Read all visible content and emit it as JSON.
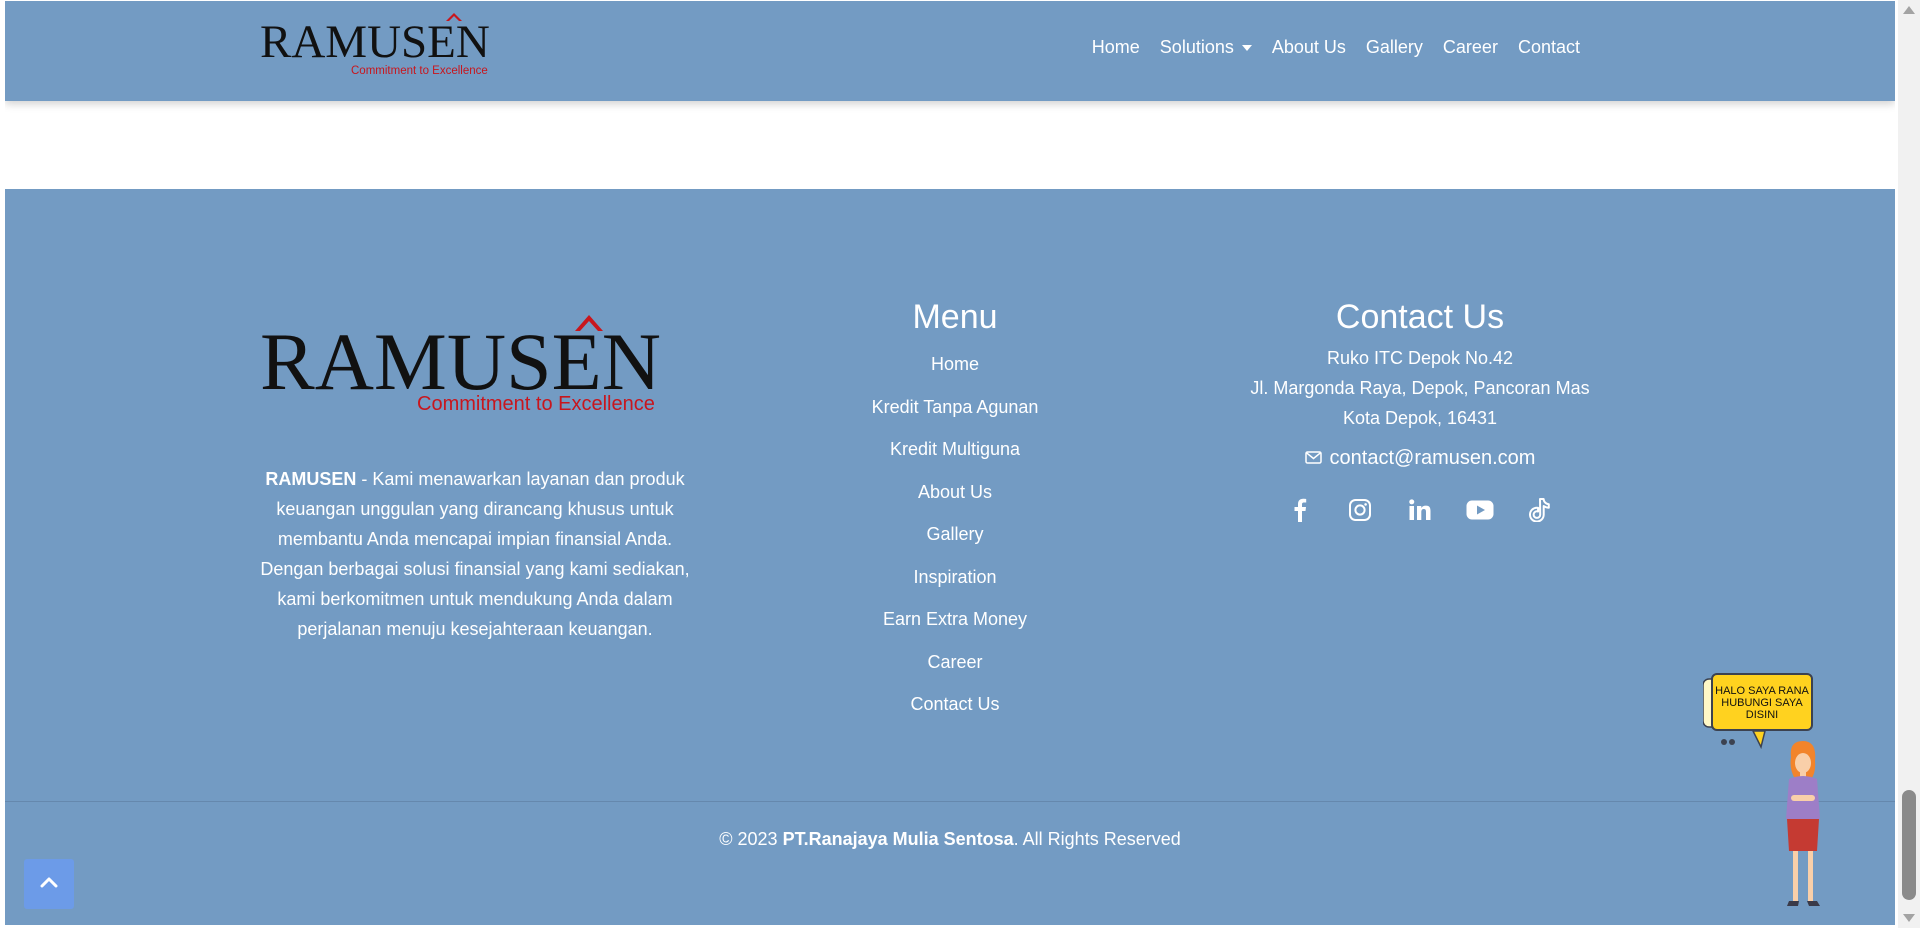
{
  "nav": {
    "logo_text": "RAMUSEN",
    "logo_tagline": "Commitment to Excellence",
    "items": [
      {
        "label": "Home"
      },
      {
        "label": "Solutions"
      },
      {
        "label": "About Us"
      },
      {
        "label": "Gallery"
      },
      {
        "label": "Career"
      },
      {
        "label": "Contact"
      }
    ]
  },
  "footer": {
    "logo_text": "RAMUSEN",
    "logo_tagline": "Commitment to Excellence",
    "about_brand": "RAMUSEN",
    "about_text": " - Kami menawarkan layanan dan produk keuangan unggulan yang dirancang khusus untuk membantu Anda mencapai impian finansial Anda. Dengan berbagai solusi finansial yang kami sediakan, kami berkomitmen untuk mendukung Anda dalam perjalanan menuju kesejahteraan keuangan.",
    "menu": {
      "heading": "Menu",
      "items": [
        {
          "label": "Home"
        },
        {
          "label": "Kredit Tanpa Agunan"
        },
        {
          "label": "Kredit Multiguna"
        },
        {
          "label": "About Us"
        },
        {
          "label": "Gallery"
        },
        {
          "label": "Inspiration"
        },
        {
          "label": "Earn Extra Money"
        },
        {
          "label": "Career"
        },
        {
          "label": "Contact Us"
        }
      ]
    },
    "contact": {
      "heading": "Contact Us",
      "address_line1": "Ruko ITC Depok No.42",
      "address_line2": "Jl. Margonda Raya, Depok, Pancoran Mas",
      "address_line3": "Kota Depok, 16431",
      "email": "contact@ramusen.com",
      "email_icon": "envelope-icon",
      "social_icons": [
        "facebook-icon",
        "instagram-icon",
        "linkedin-icon",
        "youtube-icon",
        "tiktok-icon"
      ]
    },
    "copyright_prefix": "© 2023 ",
    "copyright_company": "PT.Ranajaya Mulia Sentosa",
    "copyright_suffix": ". All Rights Reserved"
  },
  "chat_widget": {
    "bubble_text": "HALO SAYA RANA HUBUNGI SAYA DISINI"
  },
  "colors": {
    "primary": "#739bc3",
    "logo_red": "#c8161d",
    "back_to_top": "#6c9be8",
    "bubble": "#ffd21f"
  }
}
